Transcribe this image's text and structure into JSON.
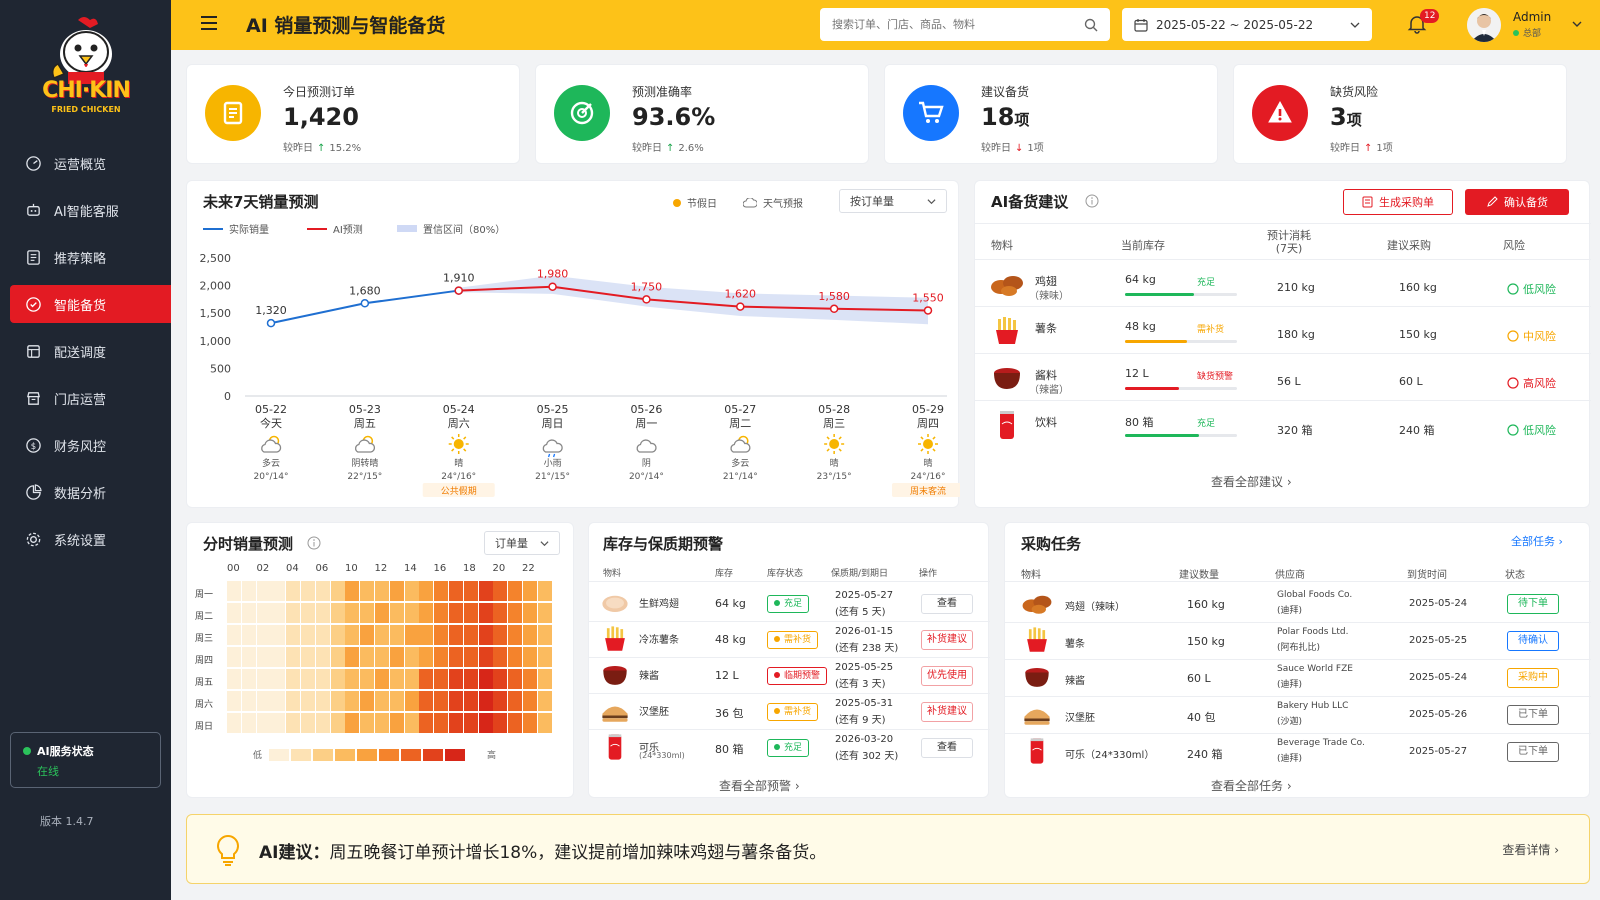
{
  "brand": {
    "logo_text": "CHI·KIN",
    "logo_sub": "FRIED CHICKEN"
  },
  "sidebar": {
    "items": [
      {
        "label": "运营概览",
        "icon": "dashboard-icon"
      },
      {
        "label": "AI智能客服",
        "icon": "robot-icon"
      },
      {
        "label": "推荐策略",
        "icon": "strategy-icon"
      },
      {
        "label": "智能备货",
        "icon": "stock-icon",
        "active": true
      },
      {
        "label": "配送调度",
        "icon": "dispatch-icon"
      },
      {
        "label": "门店运营",
        "icon": "store-icon"
      },
      {
        "label": "财务风控",
        "icon": "finance-icon"
      },
      {
        "label": "数据分析",
        "icon": "pie-icon"
      },
      {
        "label": "系统设置",
        "icon": "gear-icon"
      }
    ],
    "service_label": "AI服务状态",
    "service_status": "在线",
    "version": "版本 1.4.7"
  },
  "header": {
    "title": "AI 销量预测与智能备货",
    "search_placeholder": "搜索订单、门店、商品、物料",
    "date_range": "2025-05-22  ~  2025-05-22",
    "notifications": "12",
    "user": "Admin",
    "user_role": "总部"
  },
  "kpis": [
    {
      "label": "今日预测订单",
      "value": "1,420",
      "unit": "",
      "cmp_label": "较昨日",
      "cmp_dir": "↑",
      "cmp_value": "15.2%",
      "color": "#f7b500"
    },
    {
      "label": "预测准确率",
      "value": "93.6%",
      "unit": "",
      "cmp_label": "较昨日",
      "cmp_dir": "↑",
      "cmp_value": "2.6%",
      "color": "#1eb75a"
    },
    {
      "label": "建议备货",
      "value": "18",
      "unit": "项",
      "cmp_label": "较昨日",
      "cmp_dir": "↓",
      "cmp_value": "1项",
      "color": "#1677ff"
    },
    {
      "label": "缺货风险",
      "value": "3",
      "unit": "项",
      "cmp_label": "较昨日",
      "cmp_dir": "↑",
      "cmp_value": "1项",
      "color": "#e31b23"
    }
  ],
  "forecast": {
    "title": "未来7天销量预测",
    "legend_holiday": "节假日",
    "legend_weather": "天气预报",
    "select": "按订单量",
    "legend_actual": "实际销量",
    "legend_ai": "AI预测",
    "legend_ci": "置信区间（80%）",
    "days": [
      {
        "date": "05-22",
        "dow": "今天",
        "weather": "多云",
        "temp": "20°/14°",
        "note": ""
      },
      {
        "date": "05-23",
        "dow": "周五",
        "weather": "阴转晴",
        "temp": "22°/15°",
        "note": ""
      },
      {
        "date": "05-24",
        "dow": "周六",
        "weather": "晴",
        "temp": "24°/16°",
        "note": "公共假期"
      },
      {
        "date": "05-25",
        "dow": "周日",
        "weather": "小雨",
        "temp": "21°/15°",
        "note": ""
      },
      {
        "date": "05-26",
        "dow": "周一",
        "weather": "阴",
        "temp": "20°/14°",
        "note": ""
      },
      {
        "date": "05-27",
        "dow": "周二",
        "weather": "多云",
        "temp": "21°/14°",
        "note": ""
      },
      {
        "date": "05-28",
        "dow": "周三",
        "weather": "晴",
        "temp": "23°/15°",
        "note": ""
      },
      {
        "date": "05-29",
        "dow": "周四",
        "weather": "晴",
        "temp": "24°/16°",
        "note": "周末客流"
      }
    ]
  },
  "chart_data": {
    "type": "line",
    "categories": [
      "05-22",
      "05-23",
      "05-24",
      "05-25",
      "05-26",
      "05-27",
      "05-28",
      "05-29"
    ],
    "series": [
      {
        "name": "实际销量",
        "values": [
          1320,
          1680,
          1910,
          null,
          null,
          null,
          null,
          null
        ],
        "color": "#1f6fd1"
      },
      {
        "name": "AI预测",
        "values": [
          null,
          null,
          1910,
          1980,
          1750,
          1620,
          1580,
          1550
        ],
        "color": "#e31b23"
      }
    ],
    "ci_low": [
      null,
      null,
      1880,
      1850,
      1620,
      1450,
      1380,
      1300
    ],
    "ci_high": [
      null,
      null,
      1960,
      2180,
      1980,
      1860,
      1820,
      1780
    ],
    "y_ticks": [
      "2,500",
      "2,000",
      "1,500",
      "1,000",
      "500",
      "0"
    ],
    "ylim": [
      0,
      2500
    ],
    "data_labels": [
      "1,320",
      "1,680",
      "1,910",
      "1,980",
      "1,750",
      "1,620",
      "1,580",
      "1,550"
    ]
  },
  "stock_ai": {
    "title": "AI备货建议",
    "btn_generate": "生成采购单",
    "btn_confirm": "确认备货",
    "cols": [
      "物料",
      "当前库存",
      "预计消耗\n(7天)",
      "建议采购",
      "风险"
    ],
    "rows": [
      {
        "name": "鸡翅",
        "sub": "（辣味）",
        "stock": "64 kg",
        "tag": "充足",
        "fill": 0.62,
        "bar": "#1eb75a",
        "consume": "210 kg",
        "buy": "160 kg",
        "risk": "低风险",
        "risk_color": "#1eb75a"
      },
      {
        "name": "薯条",
        "sub": "",
        "stock": "48 kg",
        "tag": "需补货",
        "fill": 0.55,
        "bar": "#f7a600",
        "consume": "180 kg",
        "buy": "150 kg",
        "risk": "中风险",
        "risk_color": "#f7a600"
      },
      {
        "name": "酱料",
        "sub": "（辣酱）",
        "stock": "12 L",
        "tag": "缺货预警",
        "fill": 0.48,
        "bar": "#e31b23",
        "consume": "56 L",
        "buy": "60 L",
        "risk": "高风险",
        "risk_color": "#e31b23"
      },
      {
        "name": "饮料",
        "sub": "",
        "stock": "80 箱",
        "tag": "充足",
        "fill": 0.66,
        "bar": "#1eb75a",
        "consume": "320 箱",
        "buy": "240 箱",
        "risk": "低风险",
        "risk_color": "#1eb75a"
      }
    ],
    "more": "查看全部建议"
  },
  "hourly": {
    "title": "分时销量预测",
    "select": "订单量",
    "hours": [
      "00",
      "02",
      "04",
      "06",
      "10",
      "12",
      "14",
      "16",
      "18",
      "20",
      "22"
    ],
    "days": [
      "周一",
      "周二",
      "周三",
      "周四",
      "周五",
      "周六",
      "周日"
    ],
    "low": "低",
    "high": "高"
  },
  "inventory": {
    "title": "库存与保质期预警",
    "cols": [
      "物料",
      "库存",
      "库存状态",
      "保质期/到期日",
      "操作"
    ],
    "rows": [
      {
        "name": "生鲜鸡翅",
        "sub": "",
        "qty": "64 kg",
        "status": "充足",
        "sc": "#1eb75a",
        "date": "2025-05-27",
        "left": "(还有 5 天)",
        "op": "查看",
        "op_red": false
      },
      {
        "name": "冷冻薯条",
        "sub": "",
        "qty": "48 kg",
        "status": "需补货",
        "sc": "#f7a600",
        "date": "2026-01-15",
        "left": "(还有 238 天)",
        "op": "补货建议",
        "op_red": true
      },
      {
        "name": "辣酱",
        "sub": "",
        "qty": "12 L",
        "status": "临期预警",
        "sc": "#e31b23",
        "date": "2025-05-25",
        "left": "(还有 3 天)",
        "op": "优先使用",
        "op_red": true
      },
      {
        "name": "汉堡胚",
        "sub": "",
        "qty": "36 包",
        "status": "需补货",
        "sc": "#f7a600",
        "date": "2025-05-31",
        "left": "(还有 9 天)",
        "op": "补货建议",
        "op_red": true
      },
      {
        "name": "可乐",
        "sub": "(24*330ml)",
        "qty": "80 箱",
        "status": "充足",
        "sc": "#1eb75a",
        "date": "2026-03-20",
        "left": "(还有 302 天)",
        "op": "查看",
        "op_red": false
      }
    ],
    "more": "查看全部预警"
  },
  "purchase": {
    "title": "采购任务",
    "all": "全部任务",
    "cols": [
      "物料",
      "建议数量",
      "供应商",
      "到货时间",
      "状态"
    ],
    "rows": [
      {
        "name": "鸡翅（辣味）",
        "qty": "160 kg",
        "sup": "Global Foods Co.",
        "sup2": "(迪拜)",
        "date": "2025-05-24",
        "status": "待下单",
        "sc": "#1eb75a"
      },
      {
        "name": "薯条",
        "qty": "150 kg",
        "sup": "Polar Foods Ltd.",
        "sup2": "(阿布扎比)",
        "date": "2025-05-25",
        "status": "待确认",
        "sc": "#1677ff"
      },
      {
        "name": "辣酱",
        "qty": "60 L",
        "sup": "Sauce World FZE",
        "sup2": "(迪拜)",
        "date": "2025-05-24",
        "status": "采购中",
        "sc": "#f7a600"
      },
      {
        "name": "汉堡胚",
        "qty": "40 包",
        "sup": "Bakery Hub LLC",
        "sup2": "(沙迦)",
        "date": "2025-05-26",
        "status": "已下单",
        "sc": "#666666"
      },
      {
        "name": "可乐（24*330ml）",
        "qty": "240 箱",
        "sup": "Beverage Trade Co.",
        "sup2": "(迪拜)",
        "date": "2025-05-27",
        "status": "已下单",
        "sc": "#666666"
      }
    ],
    "more": "查看全部任务"
  },
  "banner": {
    "label": "AI建议：",
    "text": "周五晚餐订单预计增长18%，建议提前增加辣味鸡翅与薯条备货。",
    "more": "查看详情"
  }
}
